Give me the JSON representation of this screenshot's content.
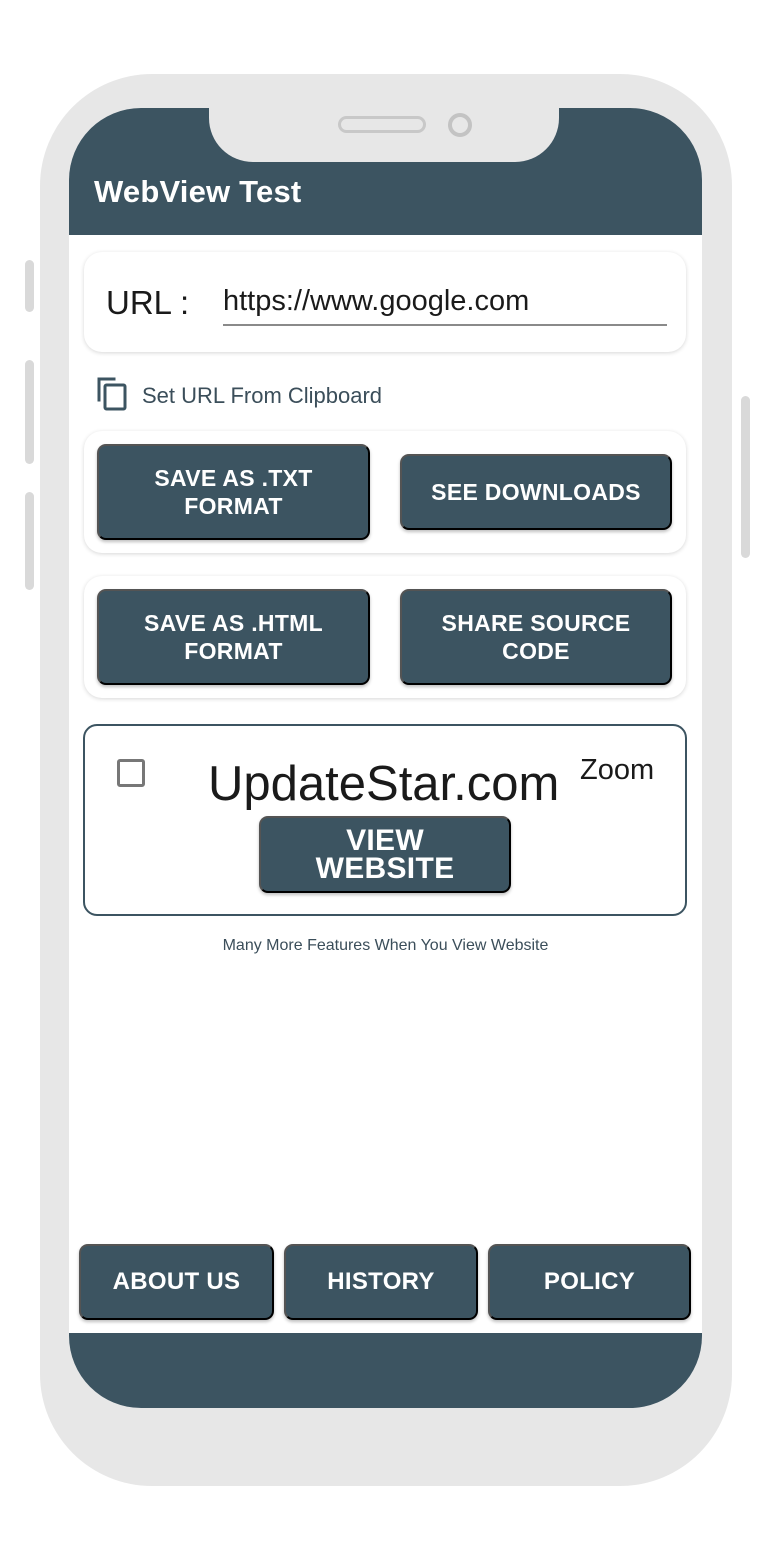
{
  "app": {
    "title": "WebView Test"
  },
  "url_card": {
    "label": "URL :",
    "value": "https://www.google.com"
  },
  "clipboard": {
    "label": "Set URL From Clipboard",
    "icon": "copy-icon"
  },
  "actions": {
    "save_txt": "SAVE AS .TXT FORMAT",
    "see_downloads": "SEE DOWNLOADS",
    "save_html": "SAVE AS .HTML FORMAT",
    "share_source": "SHARE SOURCE CODE"
  },
  "viewer": {
    "site_name": "UpdateStar.com",
    "zoom_label": "Zoom",
    "zoom_checked": false,
    "view_button": "VIEW WEBSITE",
    "note": "Many More Features When You View Website"
  },
  "bottom_nav": {
    "about": "ABOUT US",
    "history": "HISTORY",
    "policy": "POLICY"
  },
  "colors": {
    "primary": "#3c5461",
    "frame": "#e7e7e7",
    "text": "#1a1a1a"
  }
}
